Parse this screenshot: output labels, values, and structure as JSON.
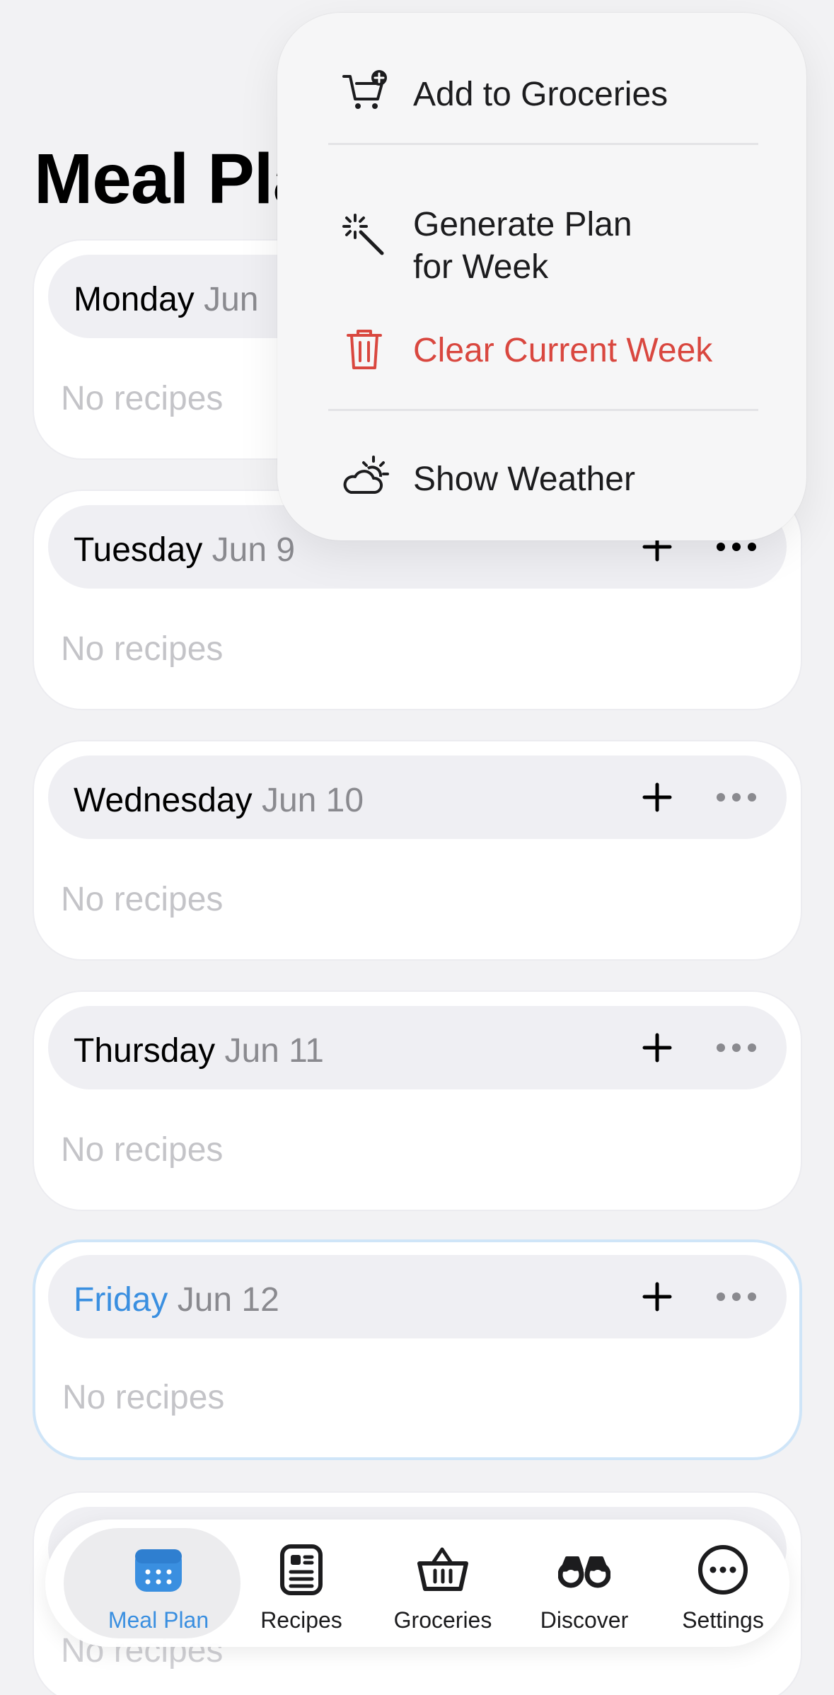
{
  "page": {
    "title": "Meal Plan"
  },
  "days": [
    {
      "name": "Monday",
      "date": "Jun",
      "empty_text": "No recipes"
    },
    {
      "name": "Tuesday",
      "date": "Jun 9",
      "empty_text": "No recipes"
    },
    {
      "name": "Wednesday",
      "date": "Jun 10",
      "empty_text": "No recipes"
    },
    {
      "name": "Thursday",
      "date": "Jun 11",
      "empty_text": "No recipes"
    },
    {
      "name": "Friday",
      "date": "Jun 12",
      "empty_text": "No recipes"
    },
    {
      "empty_text": "No recipes"
    }
  ],
  "menu": {
    "items": [
      {
        "label": "Add to Groceries",
        "icon": "cart-plus-icon"
      },
      {
        "label_line1": "Generate Plan",
        "label_line2": "for Week",
        "icon": "magic-wand-icon"
      },
      {
        "label": "Clear Current Week",
        "icon": "trash-icon",
        "color": "#d9473f"
      },
      {
        "label": "Show Weather",
        "icon": "cloud-sun-icon"
      }
    ]
  },
  "tab_bar": {
    "tabs": [
      {
        "label": "Meal Plan",
        "icon": "calendar-icon",
        "active": true
      },
      {
        "label": "Recipes",
        "icon": "recipe-card-icon"
      },
      {
        "label": "Groceries",
        "icon": "basket-icon"
      },
      {
        "label": "Discover",
        "icon": "binoculars-icon"
      },
      {
        "label": "Settings",
        "icon": "ellipsis-circle-icon"
      }
    ]
  },
  "colors": {
    "accent": "#3a8fe0",
    "danger": "#d9473f",
    "placeholder": "#c4c4c8"
  }
}
